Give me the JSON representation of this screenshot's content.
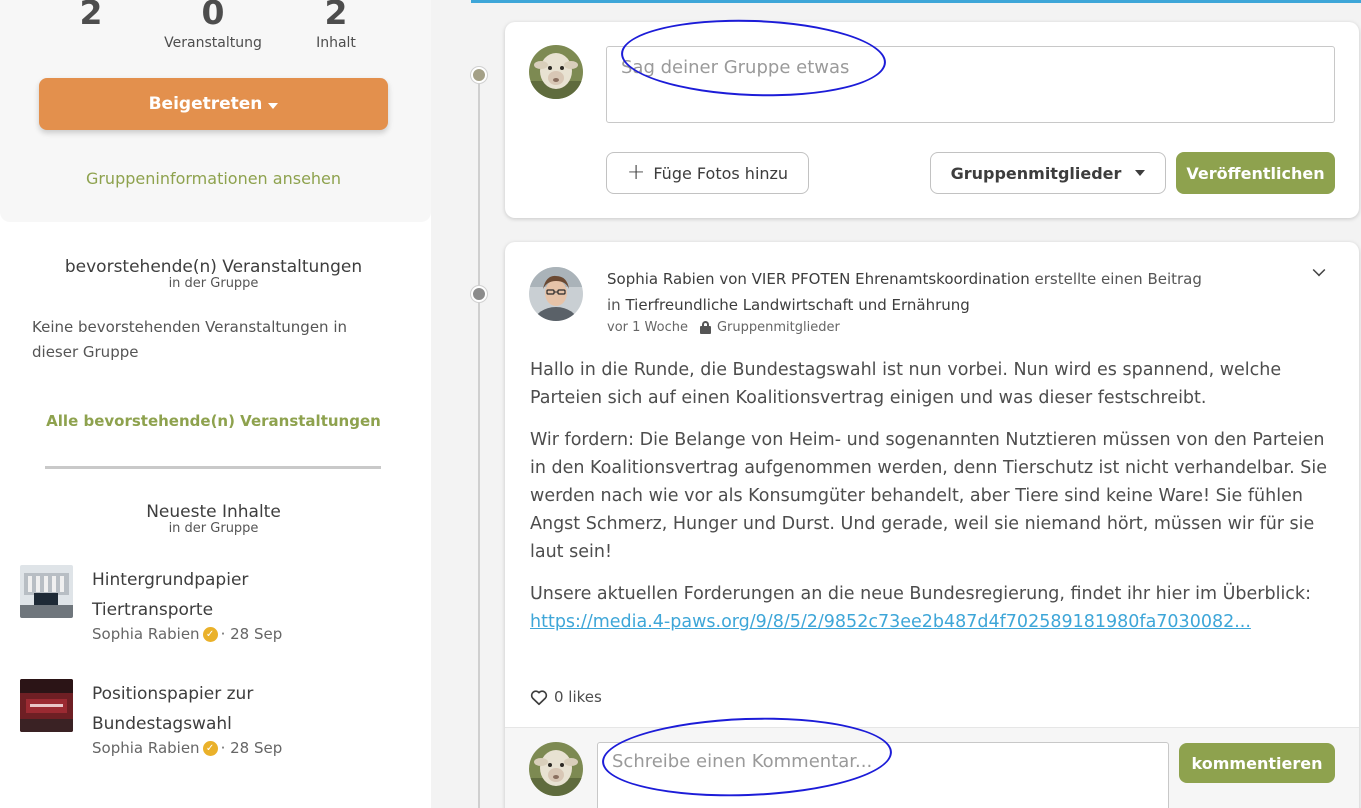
{
  "sidebar": {
    "stats": [
      {
        "value": "2",
        "label": ""
      },
      {
        "value": "0",
        "label": "Veranstaltung"
      },
      {
        "value": "2",
        "label": "Inhalt"
      }
    ],
    "joined_label": "Beigetreten",
    "group_info_link": "Gruppeninformationen ansehen",
    "events": {
      "title": "bevorstehende(n) Veranstaltungen",
      "subtitle": "in der Gruppe",
      "empty_text": "Keine bevorstehenden Veranstaltungen in dieser Gruppe",
      "all_link": "Alle bevorstehende(n) Veranstaltungen"
    },
    "latest": {
      "title": "Neueste Inhalte",
      "subtitle": "in der Gruppe",
      "items": [
        {
          "title": "Hintergrundpapier Tiertransporte",
          "author": "Sophia Rabien",
          "date": "· 28 Sep"
        },
        {
          "title": "Positionspapier zur Bundestagswahl",
          "author": "Sophia Rabien",
          "date": "· 28 Sep"
        }
      ]
    }
  },
  "composer": {
    "placeholder": "Sag deiner Gruppe etwas",
    "add_photos_label": "Füge Fotos hinzu",
    "visibility_label": "Gruppenmitglieder",
    "publish_label": "Veröffentlichen"
  },
  "post": {
    "author": "Sophia Rabien von VIER PFOTEN Ehrenamtskoordination",
    "action": "erstellte einen Beitrag",
    "in_word": "in",
    "group": "Tierfreundliche Landwirtschaft und Ernährung",
    "time": "vor 1 Woche",
    "visibility": "Gruppenmitglieder",
    "paragraphs": [
      "Hallo in die Runde, die Bundestagswahl ist nun vorbei. Nun wird es spannend, welche Parteien sich auf einen Koalitionsvertrag einigen und was dieser festschreibt.",
      "Wir fordern: Die Belange von Heim- und sogenannten Nutztieren müssen von den Parteien in den Koalitionsvertrag aufgenommen werden, denn Tierschutz ist nicht verhandelbar. Sie werden nach wie vor als Konsumgüter behandelt, aber Tiere sind keine Ware! Sie fühlen Angst Schmerz, Hunger und Durst. Und gerade, weil sie niemand hört, müssen wir für sie laut sein!",
      "Unsere aktuellen Forderungen an die neue Bundesregierung, findet ihr hier im Überblick:"
    ],
    "link_text": "https://media.4-paws.org/9/8/5/2/9852c73ee2b487d4f702589181980fa7030082...",
    "likes": "0 likes",
    "comment_placeholder": "Schreibe einen Kommentar...",
    "comment_button": "kommentieren"
  },
  "colors": {
    "accent_orange": "#e3904d",
    "accent_green": "#8ea24e",
    "link_blue": "#3ea6d8",
    "annotation_blue": "#1c1cd8"
  }
}
